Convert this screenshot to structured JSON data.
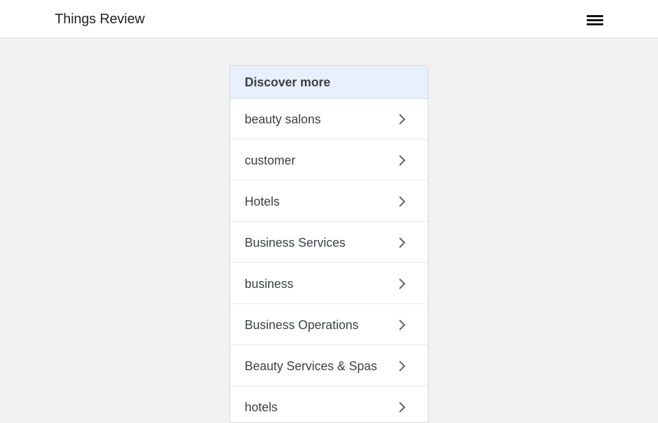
{
  "header": {
    "site_title": "Things Review",
    "menu_icon": "hamburger-menu-icon"
  },
  "discover": {
    "title": "Discover more",
    "items": [
      {
        "label": "beauty salons"
      },
      {
        "label": "customer"
      },
      {
        "label": "Hotels"
      },
      {
        "label": "Business Services"
      },
      {
        "label": "business"
      },
      {
        "label": "Business Operations"
      },
      {
        "label": "Beauty Services & Spas"
      },
      {
        "label": "hotels"
      }
    ],
    "item_icon": "chevron-right-icon"
  },
  "colors": {
    "header_bg": "#ffffff",
    "page_bg": "#f2f2f2",
    "panel_header_bg": "#e8f0fe",
    "text": "#3c4043",
    "chevron": "#5f6368"
  }
}
